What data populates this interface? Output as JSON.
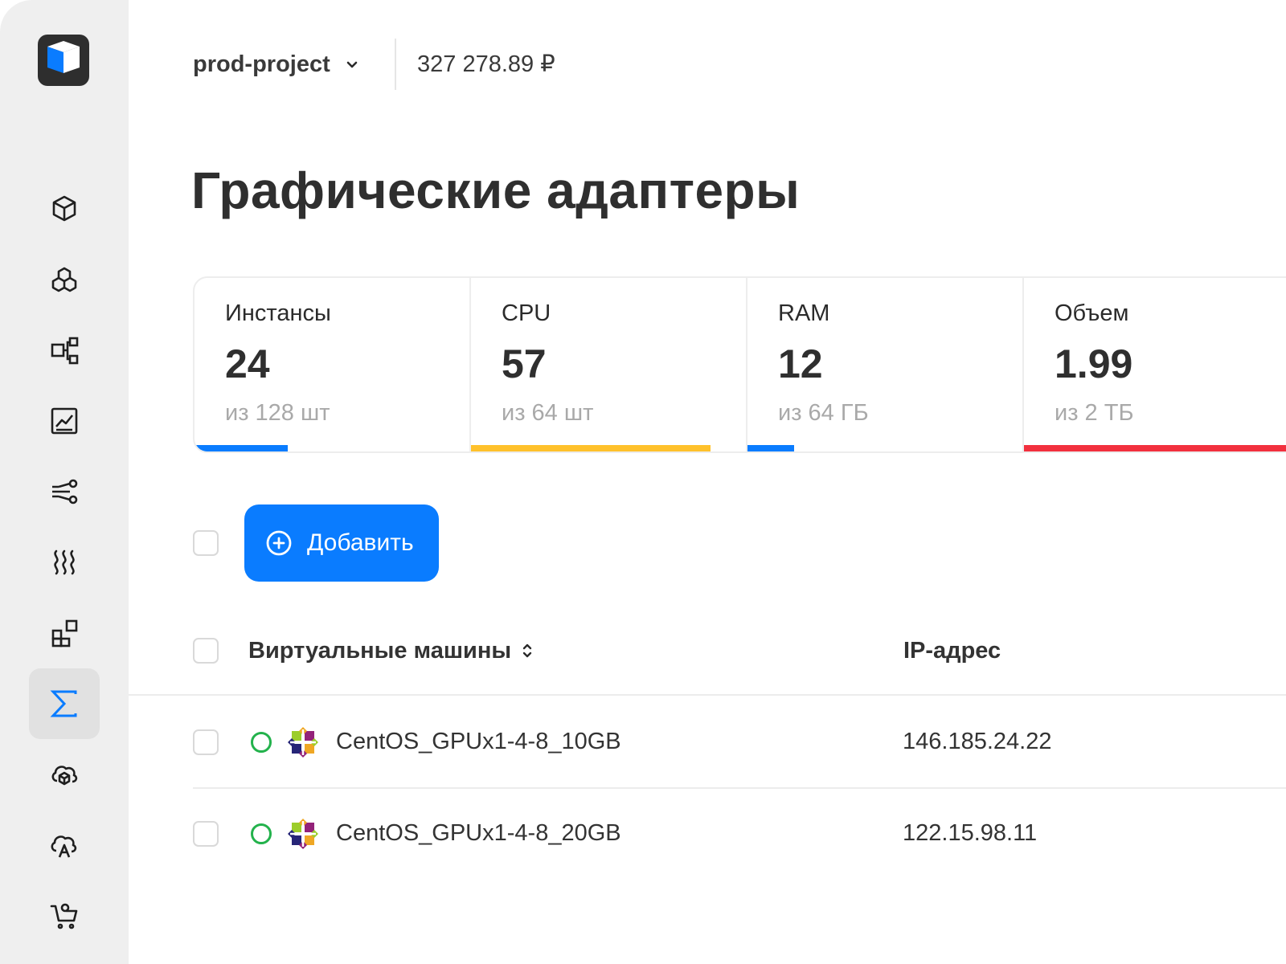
{
  "header": {
    "project_name": "prod-project",
    "balance": "327 278.89 ₽"
  },
  "page": {
    "title": "Графические адаптеры"
  },
  "sidebar": {
    "logo": "app-logo",
    "items": [
      {
        "icon": "cube-icon",
        "active": false
      },
      {
        "icon": "hexagon-cluster-icon",
        "active": false
      },
      {
        "icon": "network-topology-icon",
        "active": false
      },
      {
        "icon": "monitoring-chart-icon",
        "active": false
      },
      {
        "icon": "share-nodes-icon",
        "active": false
      },
      {
        "icon": "heat-waves-icon",
        "active": false
      },
      {
        "icon": "widgets-icon",
        "active": false
      },
      {
        "icon": "sigma-icon",
        "active": true
      },
      {
        "icon": "cloud-hexagon-icon",
        "active": false
      },
      {
        "icon": "cloud-a-icon",
        "active": false
      },
      {
        "icon": "shopping-cart-icon",
        "active": false
      }
    ]
  },
  "stats": [
    {
      "label": "Инстансы",
      "value": "24",
      "subtitle": "из 128 шт",
      "fill_fraction": 0.34,
      "color": "#0a7cff"
    },
    {
      "label": "CPU",
      "value": "57",
      "subtitle": "из 64 шт",
      "fill_fraction": 0.87,
      "color": "#ffc12b"
    },
    {
      "label": "RAM",
      "value": "12",
      "subtitle": "из 64 ГБ",
      "fill_fraction": 0.17,
      "color": "#0a7cff"
    },
    {
      "label": "Объем",
      "value": "1.99",
      "subtitle": "из 2 ТБ",
      "fill_fraction": 1.0,
      "color": "#f2303e"
    }
  ],
  "toolbar": {
    "add_label": "Добавить"
  },
  "table": {
    "columns": [
      "Виртуальные машины",
      "IP-адрес"
    ],
    "rows": [
      {
        "name": "CentOS_GPUx1-4-8_10GB",
        "ip": "146.185.24.22",
        "status": "running",
        "os_icon": "centos-icon"
      },
      {
        "name": "CentOS_GPUx1-4-8_20GB",
        "ip": "122.15.98.11",
        "status": "running",
        "os_icon": "centos-icon"
      }
    ]
  },
  "colors": {
    "accent": "#0a7cff",
    "status_ok": "#23b24c",
    "warning": "#ffc12b",
    "danger": "#f2303e",
    "sidebar_bg": "#efefef"
  }
}
